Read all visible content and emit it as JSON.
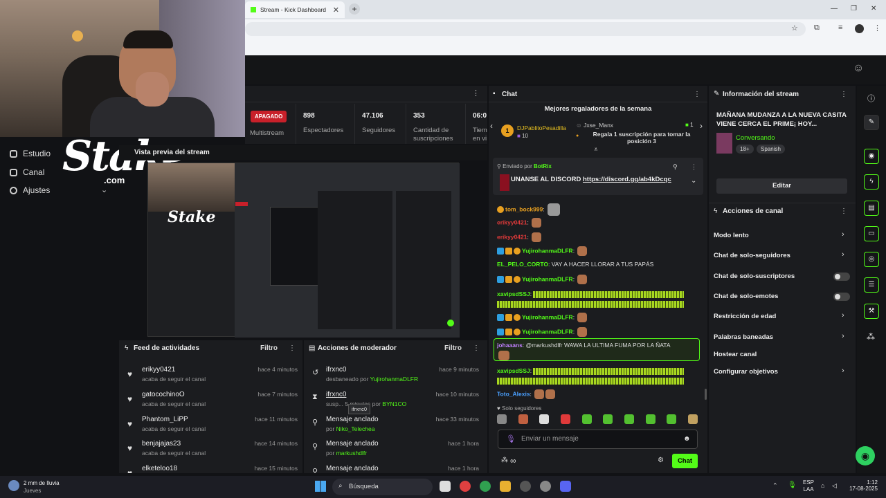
{
  "browser": {
    "tab_title": "Stream - Kick Dashboard",
    "close_glyph": "✕",
    "new_tab_glyph": "+"
  },
  "logo": {
    "text": "Stake",
    "sub": ".com"
  },
  "nav": {
    "items": [
      {
        "label": "Estudio"
      },
      {
        "label": "Canal"
      },
      {
        "label": "Ajustes"
      }
    ]
  },
  "stats": {
    "status_badge": "APAGADO",
    "multistream": "Multistream",
    "items": [
      {
        "value": "898",
        "label": "Espectadores"
      },
      {
        "value": "47.106",
        "label": "Seguidores"
      },
      {
        "value": "353",
        "label": "Cantidad de suscripciones"
      },
      {
        "value": "06:0",
        "label": "Tiem en vi"
      }
    ]
  },
  "preview": {
    "title": "Vista previa del stream"
  },
  "activity": {
    "title": "Feed de actividades",
    "filter": "Filtro",
    "items": [
      {
        "name": "erikyy0421",
        "action": "acaba de seguir el canal",
        "time": "hace 4 minutos"
      },
      {
        "name": "gatocochinoO",
        "action": "acaba de seguir el canal",
        "time": "hace 7 minutos"
      },
      {
        "name": "Phantom_LiPP",
        "action": "acaba de seguir el canal",
        "time": "hace 11 minutos"
      },
      {
        "name": "benjajajas23",
        "action": "acaba de seguir el canal",
        "time": "hace 14 minutos"
      },
      {
        "name": "elketeloo18",
        "action": "",
        "time": "hace 15 minutos"
      }
    ]
  },
  "moderator": {
    "title": "Acciones de moderador",
    "filter": "Filtro",
    "tooltip": "ifrxnc0",
    "items": [
      {
        "icon": "↺",
        "name": "ifrxnc0",
        "action": "desbaneado por",
        "by": "YujirohanmaDLFR",
        "time": "hace 9 minutos"
      },
      {
        "icon": "⧗",
        "name": "ifrxnc0",
        "action": "susp... 5 minutos por",
        "by": "BYN1CO",
        "time": "hace 10 minutos"
      },
      {
        "icon": "⚲",
        "name": "Mensaje anclado",
        "action": "por",
        "by": "Niko_Telechea",
        "time": "hace 33 minutos"
      },
      {
        "icon": "⚲",
        "name": "Mensaje anclado",
        "action": "por",
        "by": "markushdlfr",
        "time": "hace 1 hora"
      },
      {
        "icon": "⚲",
        "name": "Mensaje anclado",
        "action": "",
        "by": "",
        "time": "hace 1 hora"
      }
    ]
  },
  "chat": {
    "title": "Chat",
    "gifters_title": "Mejores regaladores de la semana",
    "gifter_rank": "1",
    "gifter_name": "DJPablitoPesadilla",
    "gifter_count": "10",
    "gifter2_name": "Jxse_Manx",
    "gifter2_count": "1",
    "gifter2_text": "Regala 1 suscripción para tomar la posición 3",
    "pinned_by_label": "Enviado por",
    "pinned_by": "BotRix",
    "pinned_text": "UNANSE AL DISCORD",
    "pinned_link": "https://discord.gg/ab4kDcqc",
    "messages": [
      {
        "user": "tom_bock999",
        "color": "#e8a020",
        "text": ""
      },
      {
        "user": "erikyy0421",
        "color": "#e03a3a",
        "text": ""
      },
      {
        "user": "erikyy0421",
        "color": "#e03a3a",
        "text": ""
      },
      {
        "user": "YujirohanmaDLFR",
        "color": "#53fc18",
        "text": ""
      },
      {
        "user": "EL_PELO_CORTO",
        "color": "#53fc18",
        "text": "VAY A HACER LLORAR A TUS PAPÁS"
      },
      {
        "user": "YujirohanmaDLFR",
        "color": "#53fc18",
        "text": ""
      },
      {
        "user": "xavipsdSSJ",
        "color": "#53fc18",
        "text": ""
      },
      {
        "user": "YujirohanmaDLFR",
        "color": "#53fc18",
        "text": ""
      },
      {
        "user": "YujirohanmaDLFR",
        "color": "#53fc18",
        "text": ""
      },
      {
        "user": "johaaans",
        "color": "#c080ff",
        "text": "@markushdlfr WAWA LA ULTIMA FUMA POR LA ÑATA"
      },
      {
        "user": "xavipsdSSJ",
        "color": "#53fc18",
        "text": ""
      },
      {
        "user": "Toto_Alexis",
        "color": "#4aa0ff",
        "text": ""
      }
    ],
    "followers_only": "Solo seguidores",
    "input_placeholder": "Enviar un mensaje",
    "send_label": "Chat"
  },
  "info": {
    "title": "Información del stream",
    "stream_title": "MAÑANA MUDANZA A LA NUEVA CASITA VIENE CERCA EL PRIME¡ HOY...",
    "category": "Conversando",
    "tags": [
      "18+",
      "Spanish"
    ],
    "edit_label": "Editar"
  },
  "actions": {
    "title": "Acciones de canal",
    "items": [
      {
        "label": "Modo lento"
      },
      {
        "label": "Chat de solo-seguidores"
      },
      {
        "label": "Chat de solo-suscriptores"
      },
      {
        "label": "Chat de solo-emotes"
      },
      {
        "label": "Restricción de edad"
      },
      {
        "label": "Palabras baneadas"
      },
      {
        "label": "Hostear canal"
      },
      {
        "label": "Configurar objetivos"
      }
    ]
  },
  "taskbar": {
    "weather": "2 mm de lluvia",
    "weather_sub": "Jueves",
    "search": "Búsqueda",
    "lang1": "ESP",
    "lang2": "LAA",
    "time": "1:12",
    "date": "17-08-2025"
  }
}
